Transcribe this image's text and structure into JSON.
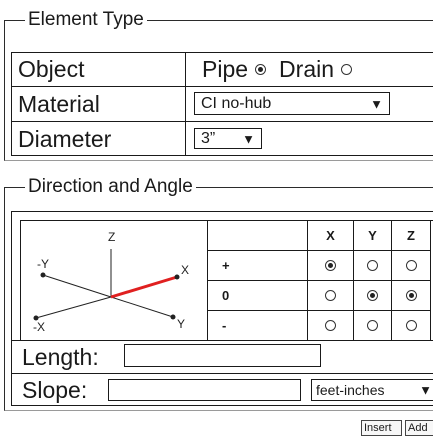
{
  "element_type": {
    "legend": "Element Type",
    "object_label": "Object",
    "pipe_label": "Pipe",
    "drain_label": "Drain",
    "selected_object": "Pipe",
    "material_label": "Material",
    "material_value": "CI no-hub",
    "diameter_label": "Diameter",
    "diameter_value": "3”"
  },
  "direction": {
    "legend": "Direction and Angle",
    "axis_labels": {
      "z": "Z",
      "neg_y": "-Y",
      "x": "X",
      "neg_x": "-X",
      "y": "Y"
    },
    "accent_color": "#e02020",
    "headers": [
      "X",
      "Y",
      "Z"
    ],
    "rows": [
      {
        "sign": "+",
        "selected": [
          true,
          false,
          false
        ]
      },
      {
        "sign": "0",
        "selected": [
          false,
          true,
          true
        ]
      },
      {
        "sign": "-",
        "selected": [
          false,
          false,
          false
        ]
      }
    ],
    "length_label": "Length:",
    "length_value": "",
    "slope_label": "Slope:",
    "slope_value": "",
    "units_value": "feet-inches"
  },
  "actions": {
    "insert_label": "Insert",
    "add_label": "Add"
  }
}
